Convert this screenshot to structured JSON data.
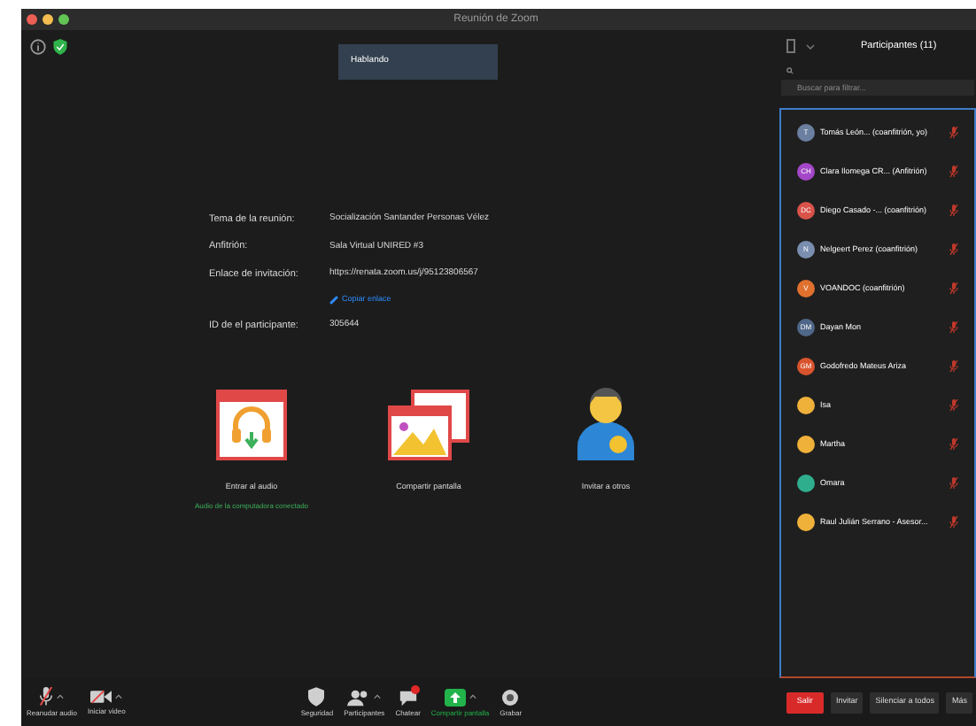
{
  "window": {
    "title": "Reunión de Zoom"
  },
  "speaker": {
    "label": "Hablando"
  },
  "meeting_info": [
    {
      "label": "Tema de la reunión:",
      "value": "Socialización Santander Personas Vélez",
      "kind": "text"
    },
    {
      "label": "Anfitrión:",
      "value": "Sala Virtual UNIRED #3",
      "kind": "text"
    },
    {
      "label": "Enlace de invitación:",
      "value": "https://renata.zoom.us/j/95123806567",
      "kind": "text"
    },
    {
      "value": "Copiar enlace",
      "kind": "link"
    },
    {
      "label": "ID de el participante:",
      "value": "305644",
      "kind": "text"
    }
  ],
  "options": [
    {
      "label": "Entrar al audio",
      "kind": "audio",
      "status": "Audio de la computadora conectado"
    },
    {
      "label": "Compartir pantalla",
      "kind": "share"
    },
    {
      "label": "Invitar a otros",
      "kind": "invite"
    }
  ],
  "participants_panel": {
    "title": "Participantes (11)",
    "search": {
      "placeholder": "Buscar para filtrar..."
    },
    "participants": [
      {
        "initials": "T",
        "name": "Tomás León...  (coanfitrión, yo)",
        "color": "#6b7fa0",
        "muted": true
      },
      {
        "initials": "CH",
        "name": "Clara Ilomega CR...  (Anfitrión)",
        "color": "#a347c8",
        "muted": true
      },
      {
        "initials": "DC",
        "name": "Diego Casado -...  (coanfitrión)",
        "color": "#d9534a",
        "muted": true
      },
      {
        "initials": "N",
        "name": "Nelgeert Perez (coanfitrión)",
        "color": "#7a8fb0",
        "muted": true
      },
      {
        "initials": "V",
        "name": "VOANDOC (coanfitrión)",
        "color": "#e0702e",
        "muted": true
      },
      {
        "initials": "DM",
        "name": "Dayan Mon",
        "color": "#4f6788",
        "muted": true
      },
      {
        "initials": "GM",
        "name": "Godofredo Mateus Ariza",
        "color": "#d9542e",
        "muted": true
      },
      {
        "name": "Isa",
        "color": "#f0b13a",
        "muted": true
      },
      {
        "name": "Martha",
        "color": "#f0b13a",
        "muted": true
      },
      {
        "name": "Omara",
        "color": "#2fae8e",
        "muted": true
      },
      {
        "name": "Raul Julián Serrano - Asesor...",
        "color": "#f0b13a",
        "muted": true
      }
    ]
  },
  "toolbar": [
    {
      "label": "Reanudar audio",
      "kind": "mic",
      "caret": true
    },
    {
      "label": "Iniciar video",
      "kind": "video",
      "caret": true
    },
    {
      "label": "Seguridad",
      "kind": "shield",
      "caret": false
    },
    {
      "label": "Participantes",
      "kind": "people",
      "caret": true
    },
    {
      "label": "Chatear",
      "kind": "chat",
      "caret": false
    },
    {
      "label": "Compartir pantalla",
      "kind": "share",
      "caret": true
    },
    {
      "label": "Grabar",
      "kind": "record",
      "caret": false
    }
  ],
  "panel_buttons": [
    {
      "label": "Salir",
      "kind": "leave"
    },
    {
      "label": "Invitar",
      "kind": "normal"
    },
    {
      "label": "Silenciar a todos",
      "kind": "normal"
    },
    {
      "label": "Más",
      "kind": "more"
    }
  ]
}
